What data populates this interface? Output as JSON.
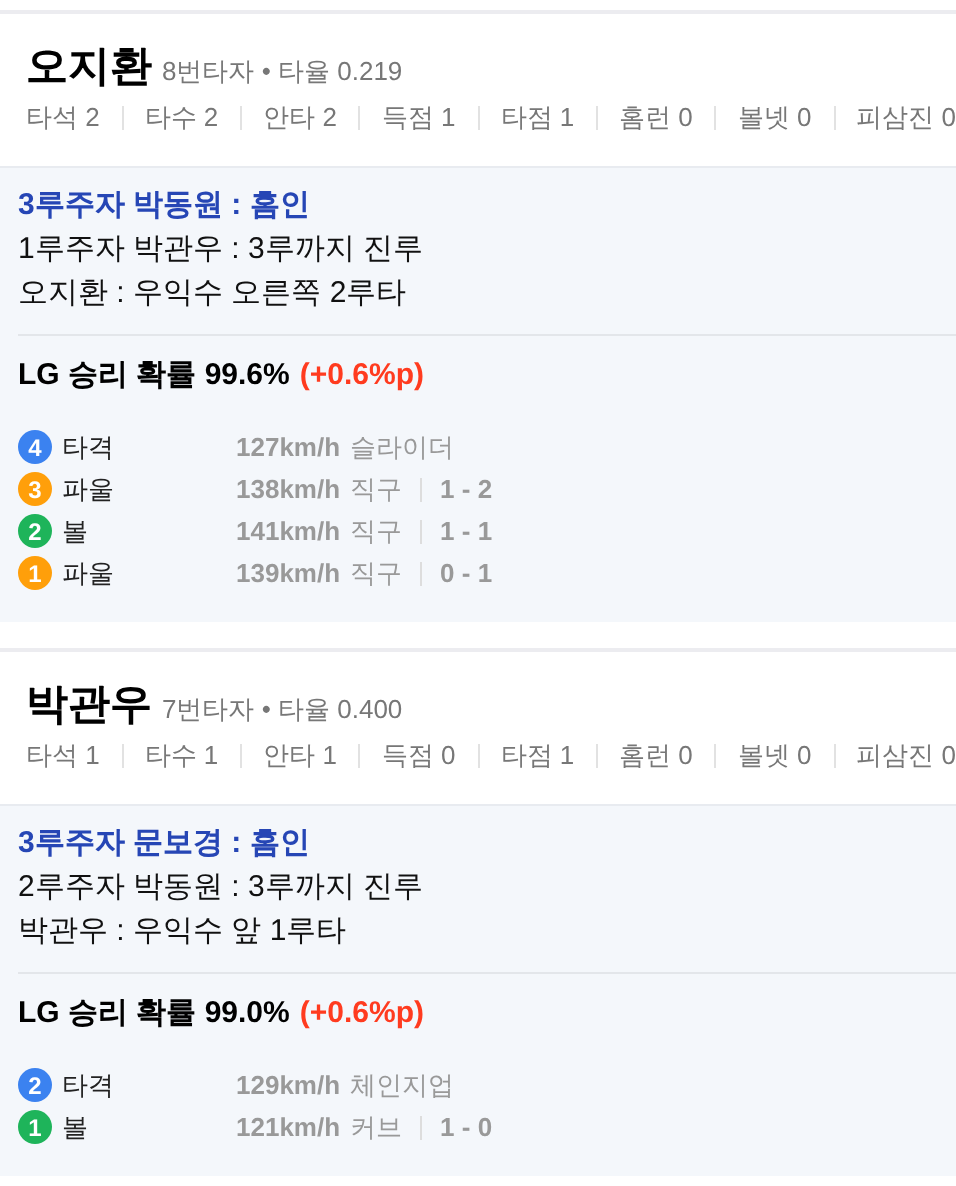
{
  "players": [
    {
      "name": "오지환",
      "meta": "8번타자 • 타율 0.219",
      "stats": [
        {
          "label": "타석",
          "value": "2"
        },
        {
          "label": "타수",
          "value": "2"
        },
        {
          "label": "안타",
          "value": "2"
        },
        {
          "label": "득점",
          "value": "1"
        },
        {
          "label": "타점",
          "value": "1"
        },
        {
          "label": "홈런",
          "value": "0"
        },
        {
          "label": "볼넷",
          "value": "0"
        },
        {
          "label": "피삼진",
          "value": "0"
        }
      ],
      "events": [
        {
          "kind": "score",
          "text": "3루주자 박동원 : 홈인"
        },
        {
          "kind": "normal",
          "text": "1루주자 박관우 : 3루까지 진루"
        },
        {
          "kind": "normal",
          "text": "오지환 : 우익수 오른쪽 2루타"
        }
      ],
      "win_prob": {
        "text": "LG 승리 확률 99.6%",
        "delta": "(+0.6%p)"
      },
      "pitches": [
        {
          "number": "4",
          "color": "#3b82f0",
          "result": "타격",
          "speed": "127km/h",
          "type": "슬라이더"
        },
        {
          "number": "3",
          "color": "#ff9f0a",
          "result": "파울",
          "speed": "138km/h",
          "type": "직구",
          "count": "1 - 2"
        },
        {
          "number": "2",
          "color": "#1eb45a",
          "result": "볼",
          "speed": "141km/h",
          "type": "직구",
          "count": "1 - 1"
        },
        {
          "number": "1",
          "color": "#ff9f0a",
          "result": "파울",
          "speed": "139km/h",
          "type": "직구",
          "count": "0 - 1"
        }
      ]
    },
    {
      "name": "박관우",
      "meta": "7번타자 • 타율 0.400",
      "stats": [
        {
          "label": "타석",
          "value": "1"
        },
        {
          "label": "타수",
          "value": "1"
        },
        {
          "label": "안타",
          "value": "1"
        },
        {
          "label": "득점",
          "value": "0"
        },
        {
          "label": "타점",
          "value": "1"
        },
        {
          "label": "홈런",
          "value": "0"
        },
        {
          "label": "볼넷",
          "value": "0"
        },
        {
          "label": "피삼진",
          "value": "0"
        }
      ],
      "events": [
        {
          "kind": "score",
          "text": "3루주자 문보경 : 홈인"
        },
        {
          "kind": "normal",
          "text": "2루주자 박동원 : 3루까지 진루"
        },
        {
          "kind": "normal",
          "text": "박관우 : 우익수 앞 1루타"
        }
      ],
      "win_prob": {
        "text": "LG 승리 확률 99.0%",
        "delta": "(+0.6%p)"
      },
      "pitches": [
        {
          "number": "2",
          "color": "#3b82f0",
          "result": "타격",
          "speed": "129km/h",
          "type": "체인지업"
        },
        {
          "number": "1",
          "color": "#1eb45a",
          "result": "볼",
          "speed": "121km/h",
          "type": "커브",
          "count": "1 - 0"
        }
      ]
    }
  ]
}
